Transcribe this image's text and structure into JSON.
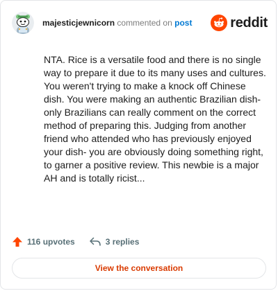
{
  "header": {
    "username": "majesticjewnicorn",
    "action_text": "commented on",
    "post_link": "post",
    "brand": "reddit"
  },
  "comment": {
    "text": "NTA. Rice is a versatile food and there is no single way to prepare it due to its many uses and cultures. You weren't trying to make a knock off Chinese dish. You were making an authentic Brazilian dish- only Brazilians can really comment on the correct method of preparing this. Judging from another friend who attended who has previously enjoyed your dish- you are obviously doing something right, to garner a positive review. This newbie is a major AH and is totally ricist..."
  },
  "footer": {
    "upvotes": "116 upvotes",
    "replies": "3 replies"
  },
  "cta": {
    "label": "View the conversation"
  },
  "colors": {
    "brand_orange": "#ff4500",
    "link_blue": "#0079d3",
    "cta_text": "#d93a00"
  },
  "icons": {
    "avatar": "snoo-avatar",
    "brand": "reddit-logo-icon",
    "upvote": "upvote-arrow-icon",
    "reply": "reply-icon"
  }
}
